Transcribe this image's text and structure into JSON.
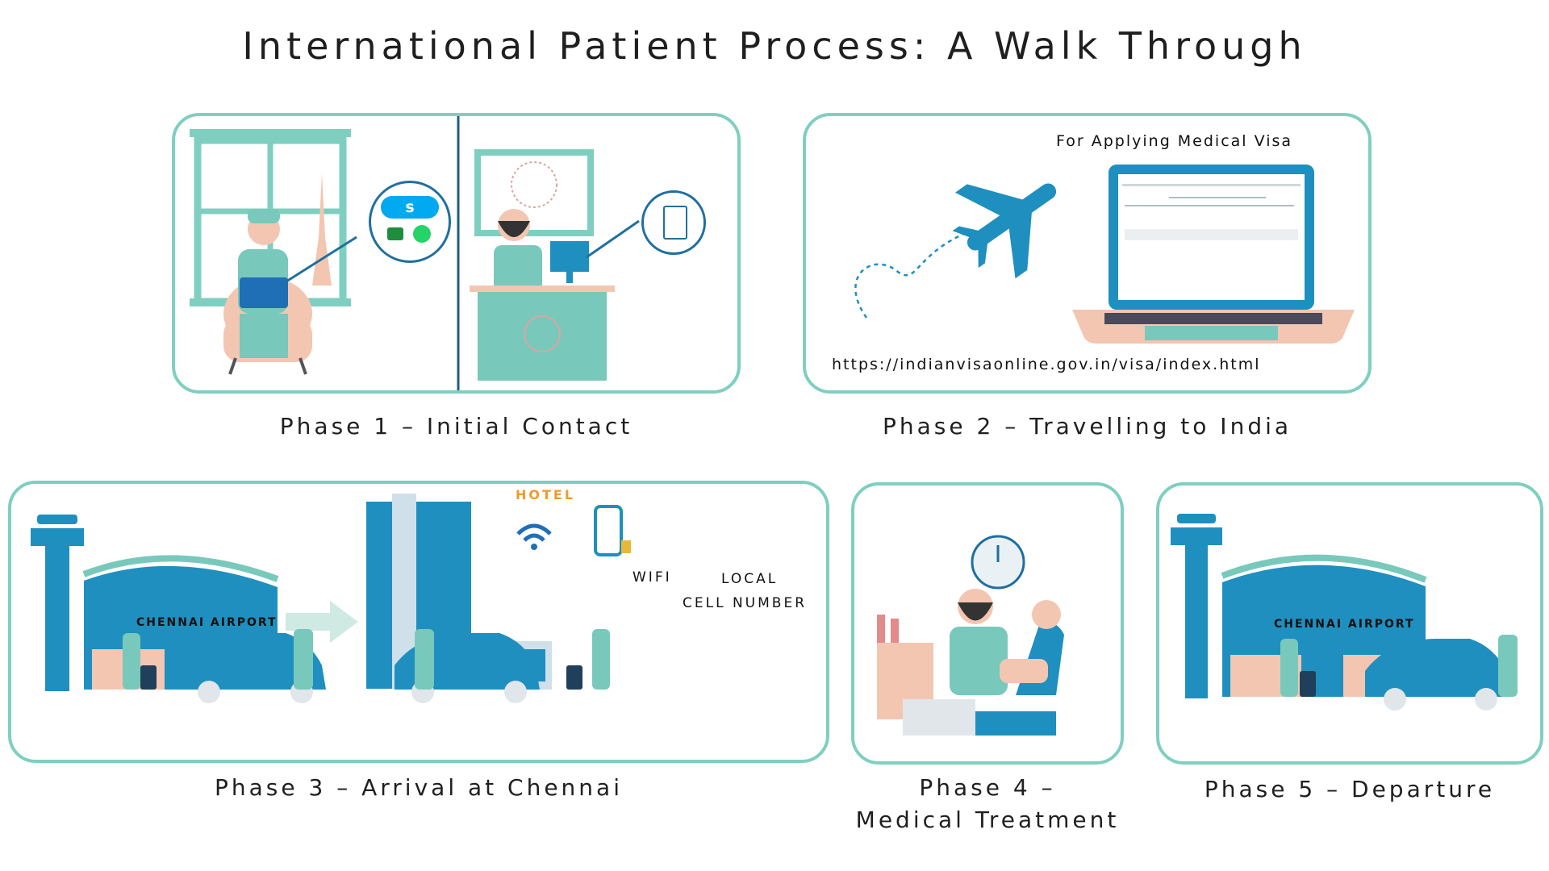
{
  "title": "International Patient Process: A Walk Through",
  "phases": [
    {
      "caption": "Phase 1 – Initial Contact"
    },
    {
      "caption": "Phase 2 – Travelling to India",
      "heading": "For Applying Medical Visa",
      "url": "https://indianvisaonline.gov.in/visa/index.html"
    },
    {
      "caption": "Phase 3 – Arrival at Chennai",
      "airport": "CHENNAI AIRPORT",
      "hotel": "HOTEL",
      "wifi": "WIFI",
      "cell_line1": "LOCAL",
      "cell_line2": "CELL NUMBER"
    },
    {
      "caption_line1": "Phase 4 –",
      "caption_line2": "Medical Treatment"
    },
    {
      "caption": "Phase 5 – Departure",
      "airport": "CHENNAI AIRPORT"
    }
  ],
  "icons": [
    "skype-icon",
    "google-meet-icon",
    "whatsapp-icon",
    "clipboard-icon",
    "airplane-icon",
    "laptop-icon",
    "wifi-icon",
    "smartphone-icon",
    "clock-icon",
    "arrow-right-icon"
  ],
  "colors": {
    "border": "#7fcfc0",
    "teal": "#78c9bb",
    "blue": "#1f8fbf",
    "dark_blue": "#1b6f96",
    "peach": "#f3c6b2"
  }
}
